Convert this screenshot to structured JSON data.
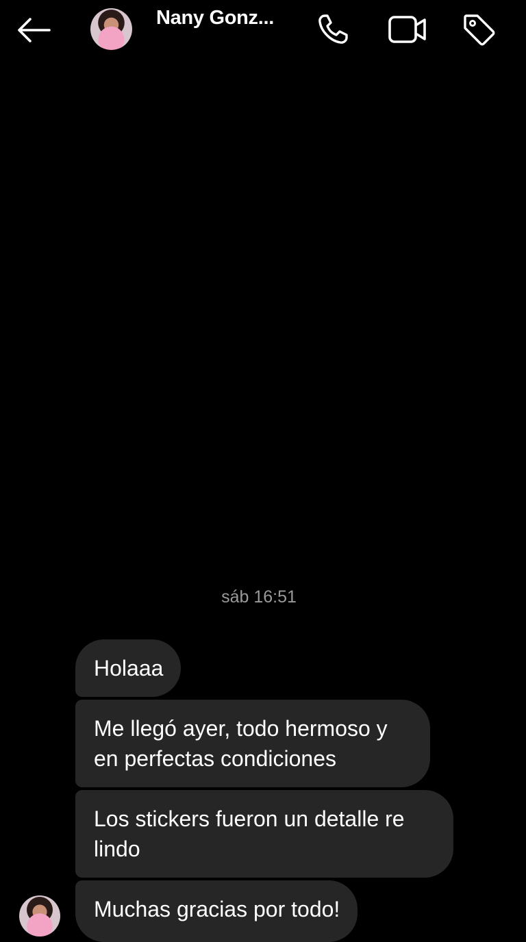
{
  "header": {
    "contact_name": "Nany Gonz...",
    "back_icon": "arrow-left-icon",
    "call_icon": "phone-icon",
    "video_icon": "video-camera-icon",
    "tag_icon": "tag-icon"
  },
  "conversation": {
    "timestamp": "sáb 16:51",
    "messages": [
      {
        "text": "Holaaa"
      },
      {
        "text": "Me llegó ayer, todo hermoso y en perfectas condiciones"
      },
      {
        "text": "Los stickers fueron un detalle re lindo"
      },
      {
        "text": "Muchas gracias por todo!"
      }
    ]
  },
  "colors": {
    "background": "#000000",
    "bubble": "#262626",
    "text": "#ffffff",
    "timestamp": "#9a9a9a"
  }
}
